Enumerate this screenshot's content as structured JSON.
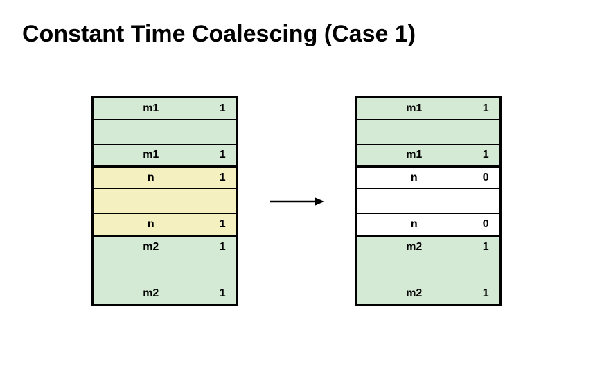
{
  "title": "Constant Time Coalescing (Case 1)",
  "left": {
    "r0": {
      "size": "m1",
      "flag": "1"
    },
    "r2": {
      "size": "m1",
      "flag": "1"
    },
    "r3": {
      "size": "n",
      "flag": "1"
    },
    "r5": {
      "size": "n",
      "flag": "1"
    },
    "r6": {
      "size": "m2",
      "flag": "1"
    },
    "r8": {
      "size": "m2",
      "flag": "1"
    }
  },
  "right": {
    "r0": {
      "size": "m1",
      "flag": "1"
    },
    "r2": {
      "size": "m1",
      "flag": "1"
    },
    "r3": {
      "size": "n",
      "flag": "0"
    },
    "r5": {
      "size": "n",
      "flag": "0"
    },
    "r6": {
      "size": "m2",
      "flag": "1"
    },
    "r8": {
      "size": "m2",
      "flag": "1"
    }
  }
}
